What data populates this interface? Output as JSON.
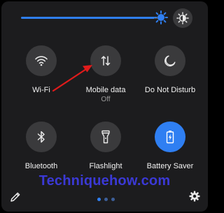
{
  "colors": {
    "accent": "#2f7ff2",
    "tile_inactive": "#3a3a3c",
    "tile_active": "#2f7ff2",
    "annotation_arrow": "#e01b1b",
    "watermark": "#3b39d6"
  },
  "brightness": {
    "level_percent": 95,
    "thumb_icon": "brightness-sun-icon",
    "auto_icon": "auto-brightness-icon"
  },
  "tiles": [
    {
      "label": "Wi-Fi",
      "icon": "wifi-icon",
      "active": false
    },
    {
      "label": "Mobile data",
      "sub": "Off",
      "icon": "mobile-data-icon",
      "active": false
    },
    {
      "label": "Do Not Disturb",
      "icon": "moon-icon",
      "active": false
    },
    {
      "label": "Bluetooth",
      "icon": "bluetooth-icon",
      "active": false
    },
    {
      "label": "Flashlight",
      "icon": "flashlight-icon",
      "active": false
    },
    {
      "label": "Battery Saver",
      "icon": "battery-icon",
      "active": true
    }
  ],
  "watermark": "Techniquehow.com",
  "footer": {
    "edit_icon": "pencil-icon",
    "settings_icon": "gear-icon",
    "pages": 3,
    "current_page": 1
  }
}
